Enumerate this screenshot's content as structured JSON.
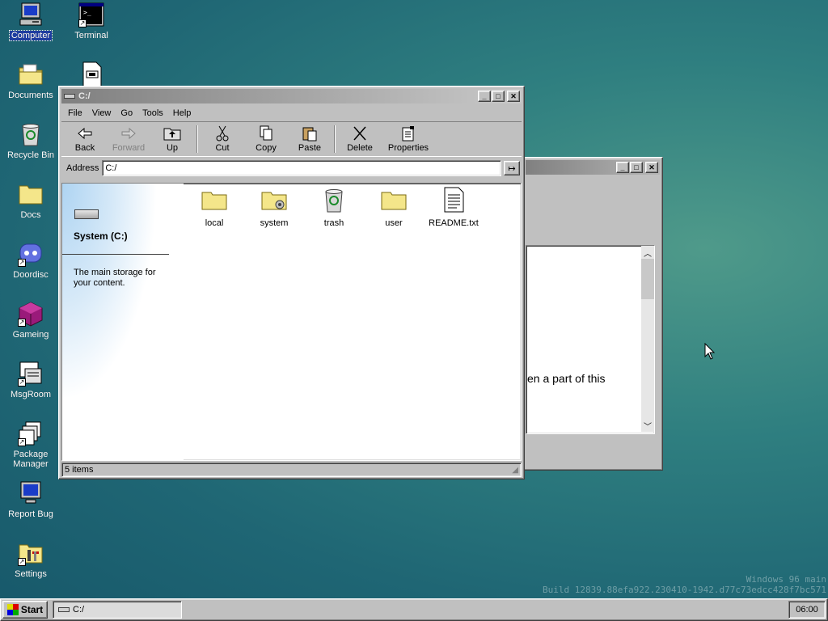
{
  "desktop": {
    "icons": [
      {
        "label": "Computer",
        "icon": "computer-icon"
      },
      {
        "label": "Terminal",
        "icon": "terminal-icon"
      },
      {
        "label": "Documents",
        "icon": "documents-folder-icon"
      },
      {
        "label": "Recycle Bin",
        "icon": "recycle-bin-icon"
      },
      {
        "label": "Docs",
        "icon": "folder-icon"
      },
      {
        "label": "Doordisc",
        "icon": "doordisc-icon"
      },
      {
        "label": "Gameing",
        "icon": "cube-icon"
      },
      {
        "label": "MsgRoom",
        "icon": "msgroom-icon"
      },
      {
        "label": "Package Manager",
        "icon": "package-manager-icon"
      },
      {
        "label": "Report Bug",
        "icon": "monitor-icon"
      },
      {
        "label": "Settings",
        "icon": "settings-icon"
      }
    ],
    "watermark": {
      "line1": "Windows 96 main",
      "line2": "Build 12839.88efa922.230410-1942.d77c73edcc428f7bc571"
    },
    "colors": {
      "desktop": "#2f7f80",
      "title_active": "#000080",
      "window_face": "#c0c0c0"
    }
  },
  "explorer": {
    "title": "C:/",
    "menu": [
      "File",
      "View",
      "Go",
      "Tools",
      "Help"
    ],
    "toolbar": {
      "back": "Back",
      "forward": "Forward",
      "up": "Up",
      "cut": "Cut",
      "copy": "Copy",
      "paste": "Paste",
      "delete": "Delete",
      "properties": "Properties"
    },
    "address_label": "Address",
    "address_value": "C:/",
    "sidepanel": {
      "title": "System (C:)",
      "description": "The main storage for your content."
    },
    "files": [
      {
        "name": "local",
        "icon": "folder-icon"
      },
      {
        "name": "system",
        "icon": "system-folder-icon"
      },
      {
        "name": "trash",
        "icon": "recycle-bin-icon"
      },
      {
        "name": "user",
        "icon": "folder-icon"
      },
      {
        "name": "README.txt",
        "icon": "text-file-icon"
      }
    ],
    "status": "5 items"
  },
  "background_window": {
    "visible_text": "en a part of this"
  },
  "taskbar": {
    "start_label": "Start",
    "task_label": "C:/",
    "clock": "06:00"
  }
}
